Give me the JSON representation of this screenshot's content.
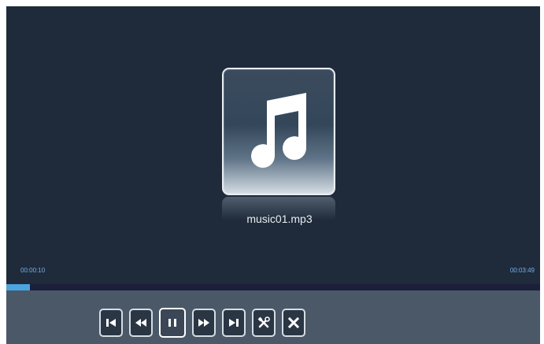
{
  "player": {
    "file_name": "music01.mp3",
    "current_time": "00:00:10",
    "total_time": "00:03:49",
    "progress_fraction": 0.044
  },
  "controls": [
    {
      "name": "previous-button",
      "icon": "skip-previous-icon"
    },
    {
      "name": "rewind-button",
      "icon": "rewind-icon"
    },
    {
      "name": "pause-button",
      "icon": "pause-icon"
    },
    {
      "name": "fast-forward-button",
      "icon": "fast-forward-icon"
    },
    {
      "name": "next-button",
      "icon": "skip-next-icon"
    },
    {
      "name": "tools-button",
      "icon": "tools-icon"
    },
    {
      "name": "close-button",
      "icon": "close-icon"
    }
  ],
  "colors": {
    "background": "#1f2b3b",
    "progress": "#4ca4df",
    "time_text": "#78aee7",
    "control_bar": "#4b5868"
  }
}
